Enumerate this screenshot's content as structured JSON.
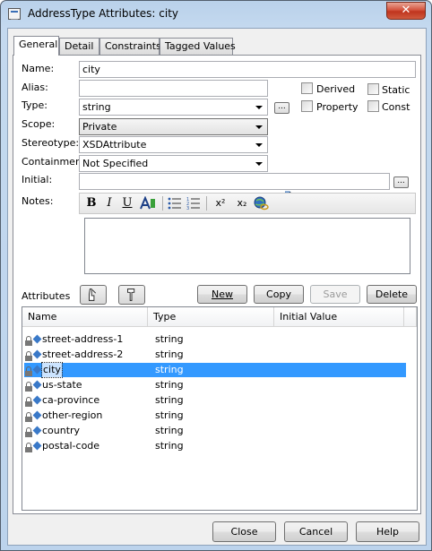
{
  "window": {
    "title": "AddressType Attributes: city",
    "close_glyph": "✕"
  },
  "tabs": [
    "General",
    "Detail",
    "Constraints",
    "Tagged Values"
  ],
  "form": {
    "name_label": "Name:",
    "name_value": "city",
    "alias_label": "Alias:",
    "alias_value": "",
    "type_label": "Type:",
    "type_value": "string",
    "scope_label": "Scope:",
    "scope_value": "Private",
    "stereotype_label": "Stereotype:",
    "stereotype_value": "XSDAttribute",
    "containment_label": "Containment:",
    "containment_value": "Not Specified",
    "initial_label": "Initial:",
    "initial_value": "",
    "notes_label": "Notes:",
    "dots": "...",
    "checkboxes": {
      "derived": "Derived",
      "static": "Static",
      "property": "Property",
      "const": "Const"
    }
  },
  "toolbar": {
    "bold": "B",
    "italic": "I",
    "underline": "U",
    "superscript": "x²",
    "subscript": "x₂"
  },
  "attributes": {
    "label": "Attributes",
    "buttons": {
      "new": "New",
      "copy": "Copy",
      "save": "Save",
      "delete": "Delete"
    },
    "columns": [
      "Name",
      "Type",
      "Initial Value"
    ],
    "rows": [
      {
        "name": "street-address-1",
        "type": "string"
      },
      {
        "name": "street-address-2",
        "type": "string"
      },
      {
        "name": "city",
        "type": "string",
        "selected": true
      },
      {
        "name": "us-state",
        "type": "string"
      },
      {
        "name": "ca-province",
        "type": "string"
      },
      {
        "name": "other-region",
        "type": "string"
      },
      {
        "name": "country",
        "type": "string"
      },
      {
        "name": "postal-code",
        "type": "string"
      }
    ]
  },
  "footer": {
    "close": "Close",
    "cancel": "Cancel",
    "help": "Help"
  },
  "colors": {
    "selection": "#3399ff",
    "titlebar": "#b9d1ea",
    "close_button": "#c0341e"
  }
}
